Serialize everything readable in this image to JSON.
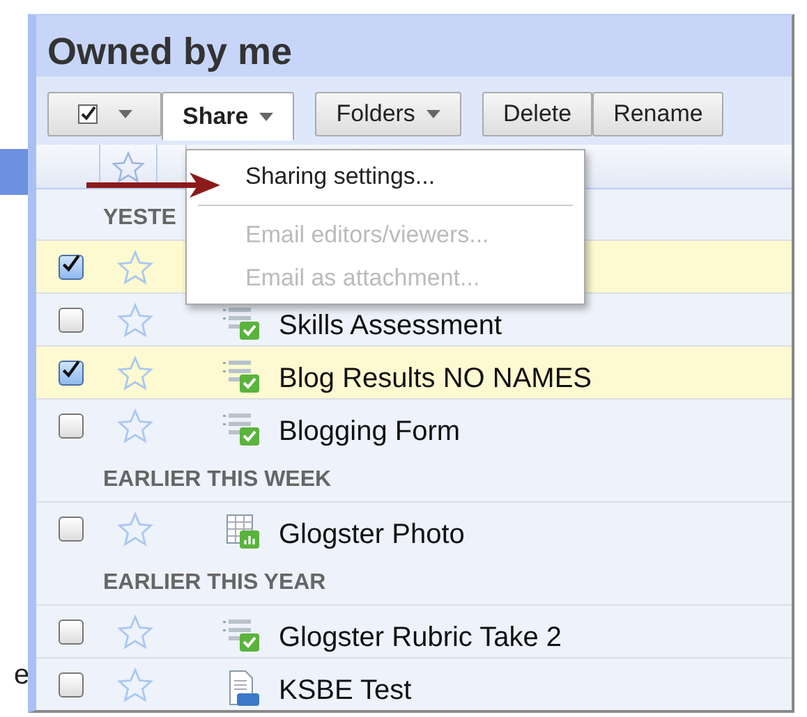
{
  "title": "Owned by me",
  "toolbar": {
    "select_menu": {
      "dropdown": true
    },
    "buttons": [
      {
        "label": "Share",
        "dropdown": true,
        "open": true
      },
      {
        "label": "Folders",
        "dropdown": true,
        "open": false
      },
      {
        "label": "Delete",
        "dropdown": false,
        "open": false
      },
      {
        "label": "Rename",
        "dropdown": false,
        "open": false
      }
    ]
  },
  "share_menu": [
    {
      "kind": "item",
      "label": "Sharing settings...",
      "disabled": false
    },
    {
      "kind": "separator"
    },
    {
      "kind": "item",
      "label": "Email editors/viewers...",
      "disabled": true
    },
    {
      "kind": "item",
      "label": "Email as attachment...",
      "disabled": true
    }
  ],
  "groups": [
    {
      "heading": "YESTE",
      "rows": [
        {
          "checked": true,
          "starred": false
        },
        {
          "name": "Skills Assessment",
          "checked": false,
          "starred": false,
          "kind": "form"
        },
        {
          "name": "Blog Results NO NAMES",
          "checked": true,
          "starred": false,
          "kind": "form"
        },
        {
          "name": "Blogging Form",
          "checked": false,
          "starred": false,
          "kind": "form"
        }
      ]
    },
    {
      "heading": "EARLIER THIS WEEK",
      "rows": [
        {
          "name": "Glogster Photo",
          "checked": false,
          "starred": false,
          "kind": "spreadsheet"
        }
      ]
    },
    {
      "heading": "EARLIER THIS YEAR",
      "rows": [
        {
          "name": "Glogster Rubric Take 2",
          "checked": false,
          "starred": false,
          "kind": "form"
        },
        {
          "name": "KSBE Test",
          "checked": false,
          "starred": false,
          "kind": "document"
        }
      ]
    }
  ],
  "background_text": "e"
}
